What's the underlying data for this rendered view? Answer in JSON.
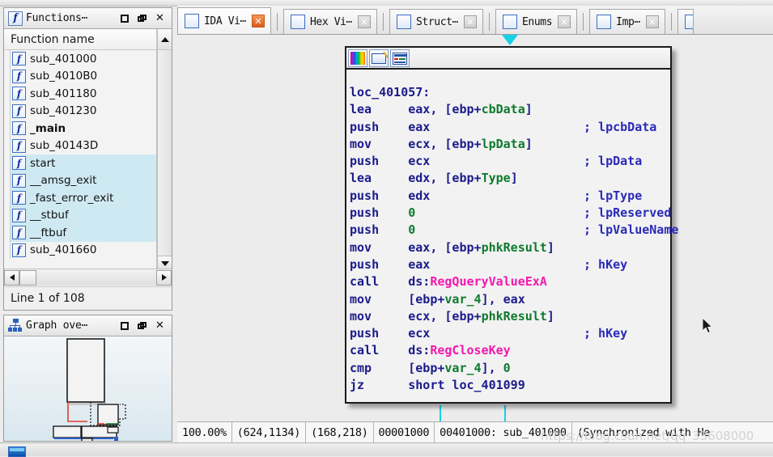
{
  "functions_window": {
    "title": "Functions⋯",
    "icon": "function-f-icon",
    "column_header": "Function name",
    "buttons": {
      "maximize": "□",
      "restore": "restore",
      "close": "✕"
    },
    "items": [
      {
        "name": "sub_401000",
        "selected": false,
        "bold": false
      },
      {
        "name": "sub_4010B0",
        "selected": false,
        "bold": false
      },
      {
        "name": "sub_401180",
        "selected": false,
        "bold": false
      },
      {
        "name": "sub_401230",
        "selected": false,
        "bold": false
      },
      {
        "name": "_main",
        "selected": false,
        "bold": true
      },
      {
        "name": "sub_40143D",
        "selected": false,
        "bold": false
      },
      {
        "name": "start",
        "selected": true,
        "bold": false
      },
      {
        "name": "__amsg_exit",
        "selected": true,
        "bold": false
      },
      {
        "name": "_fast_error_exit",
        "selected": true,
        "bold": false
      },
      {
        "name": "__stbuf",
        "selected": true,
        "bold": false
      },
      {
        "name": "__ftbuf",
        "selected": true,
        "bold": false
      },
      {
        "name": "sub_401660",
        "selected": false,
        "bold": false
      }
    ],
    "status": "Line 1 of 108"
  },
  "graph_overview_window": {
    "title": "Graph ove⋯",
    "icon": "graph-tree-icon",
    "buttons": {
      "maximize": "□",
      "restore": "restore",
      "close": "✕"
    }
  },
  "tabs": [
    {
      "label": "IDA Vi⋯",
      "icon": "ida-view-icon",
      "active": true,
      "close": "✕"
    },
    {
      "label": "Hex Vi⋯",
      "icon": "hex-view-icon",
      "active": false,
      "close": "✕"
    },
    {
      "label": "Struct⋯",
      "icon": "structures-icon",
      "active": false,
      "close": "✕"
    },
    {
      "label": "Enums",
      "icon": "enums-icon",
      "active": false,
      "close": "✕"
    },
    {
      "label": "Imp⋯",
      "icon": "imports-icon",
      "active": false,
      "close": "✕"
    }
  ],
  "node_toolbar": [
    {
      "icon": "color-palette-icon"
    },
    {
      "icon": "edit-pencil-icon"
    },
    {
      "icon": "graph-layout-icon"
    }
  ],
  "disassembly": {
    "label": "loc_401057:",
    "lines": [
      {
        "mnemonic": "lea",
        "operands": "eax, [ebp+cbData]",
        "comment": ""
      },
      {
        "mnemonic": "push",
        "operands": "eax",
        "comment": "; lpcbData"
      },
      {
        "mnemonic": "mov",
        "operands": "ecx, [ebp+lpData]",
        "comment": ""
      },
      {
        "mnemonic": "push",
        "operands": "ecx",
        "comment": "; lpData"
      },
      {
        "mnemonic": "lea",
        "operands": "edx, [ebp+Type]",
        "comment": ""
      },
      {
        "mnemonic": "push",
        "operands": "edx",
        "comment": "; lpType"
      },
      {
        "mnemonic": "push",
        "operands": "0",
        "comment": "; lpReserved"
      },
      {
        "mnemonic": "push",
        "operands": "0",
        "comment": "; lpValueName"
      },
      {
        "mnemonic": "mov",
        "operands": "eax, [ebp+phkResult]",
        "comment": ""
      },
      {
        "mnemonic": "push",
        "operands": "eax",
        "comment": "; hKey"
      },
      {
        "mnemonic": "call",
        "operands": "ds:RegQueryValueExA",
        "comment": ""
      },
      {
        "mnemonic": "mov",
        "operands": "[ebp+var_4], eax",
        "comment": ""
      },
      {
        "mnemonic": "mov",
        "operands": "ecx, [ebp+phkResult]",
        "comment": ""
      },
      {
        "mnemonic": "push",
        "operands": "ecx",
        "comment": "; hKey"
      },
      {
        "mnemonic": "call",
        "operands": "ds:RegCloseKey",
        "comment": ""
      },
      {
        "mnemonic": "cmp",
        "operands": "[ebp+var_4], 0",
        "comment": ""
      },
      {
        "mnemonic": "jz",
        "operands": "short loc_401099",
        "comment": ""
      }
    ]
  },
  "statusbar": {
    "zoom": "100.00%",
    "graph_coords": "(624,1134)",
    "screen_coords": "(168,218)",
    "file_offset": "00001000",
    "address": "00401000: sub_401000",
    "sync": "(Synchronized with He"
  },
  "watermark": "https://blog.csdn.net/qq_33608000",
  "colors": {
    "window_bg": "#ececec",
    "code_text": "#1b1b8c",
    "variable": "#0f7a2e",
    "comment": "#2a2ab8",
    "api_call": "#f21ab0",
    "edge_cyan": "#16d2e8",
    "selection": "#cfe9f2",
    "active_close": "#dd5a18"
  }
}
